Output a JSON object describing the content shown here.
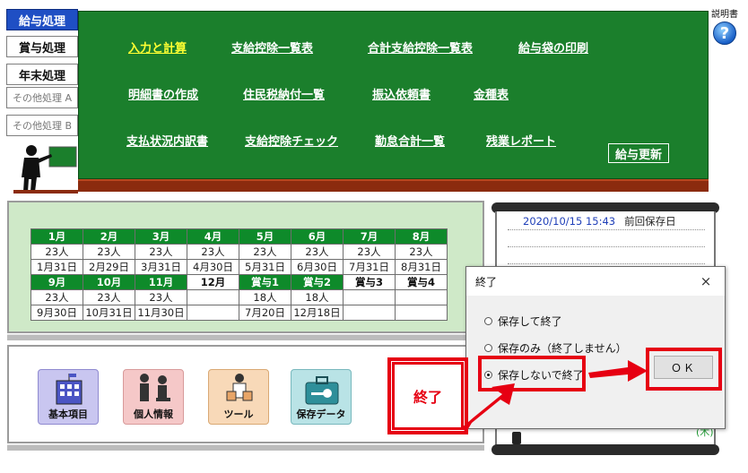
{
  "side_menu": [
    {
      "label": "給与処理",
      "active": true
    },
    {
      "label": "賞与処理",
      "active": false
    },
    {
      "label": "年末処理",
      "active": false
    },
    {
      "label": "その他処理 A",
      "active": false
    },
    {
      "label": "その他処理 B",
      "active": false
    }
  ],
  "help": {
    "label": "説明書",
    "icon": "?"
  },
  "board": {
    "links": [
      "入力と計算",
      "支給控除一覧表",
      "合計支給控除一覧表",
      "給与袋の印刷",
      "明細書の作成",
      "住民税納付一覧",
      "振込依頼書",
      "金種表",
      "支払状況内訳書",
      "支給控除チェック",
      "勤怠合計一覧",
      "残業レポート"
    ],
    "update_label": "給与更新"
  },
  "calendar": {
    "row1": {
      "months": [
        "1月",
        "2月",
        "3月",
        "4月",
        "5月",
        "6月",
        "7月",
        "8月"
      ],
      "counts": [
        "23人",
        "23人",
        "23人",
        "23人",
        "23人",
        "23人",
        "23人",
        "23人"
      ],
      "dates": [
        "1月31日",
        "2月29日",
        "3月31日",
        "4月30日",
        "5月31日",
        "6月30日",
        "7月31日",
        "8月31日"
      ]
    },
    "row2": {
      "months": [
        "9月",
        "10月",
        "11月",
        "12月",
        "賞与1",
        "賞与2",
        "賞与3",
        "賞与4"
      ],
      "counts": [
        "23人",
        "23人",
        "23人",
        "",
        "18人",
        "18人",
        "",
        ""
      ],
      "dates": [
        "9月30日",
        "10月31日",
        "11月30日",
        "",
        "7月20日",
        "12月18日",
        "",
        ""
      ]
    }
  },
  "tiles": {
    "basic": "基本項目",
    "personal": "個人情報",
    "tool": "ツール",
    "save": "保存データ"
  },
  "quit_label": "終了",
  "notebook": {
    "saved_at": "2020/10/15 15:43",
    "saved_label": "前回保存日",
    "day": "(木)"
  },
  "dialog": {
    "title": "終了",
    "close_icon": "×",
    "options": [
      "保存して終了",
      "保存のみ（終了しません）",
      "保存しないで終了"
    ],
    "selected_option": "保存しないで終了",
    "ok_label": "ＯＫ"
  },
  "colors": {
    "board": "#1b7f2c",
    "highlight": "#e60012",
    "active_menu": "#1f4fc4"
  }
}
